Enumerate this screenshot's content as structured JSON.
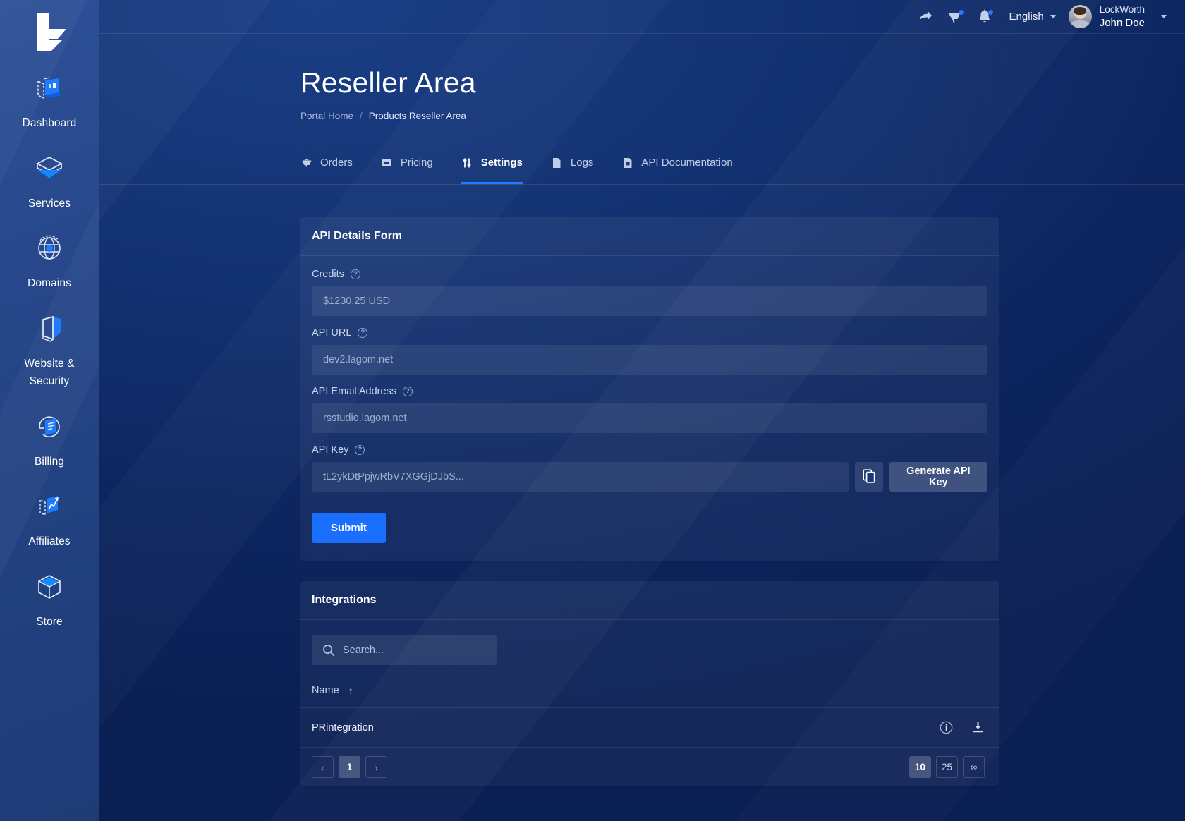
{
  "brand": {
    "logo_icon": "lagom-logo-icon"
  },
  "sidebar": {
    "items": [
      {
        "label": "Dashboard",
        "icon": "dashboard-icon"
      },
      {
        "label": "Services",
        "icon": "services-box-icon"
      },
      {
        "label": "Domains",
        "icon": "domains-globe-icon"
      },
      {
        "label": "Website &\nSecurity",
        "label_line1": "Website &",
        "label_line2": "Security",
        "icon": "website-security-shield-icon"
      },
      {
        "label": "Billing",
        "icon": "billing-invoice-icon"
      },
      {
        "label": "Affiliates",
        "icon": "affiliates-chart-icon"
      },
      {
        "label": "Store",
        "icon": "store-cube-icon"
      }
    ]
  },
  "topbar": {
    "share_icon": "share-arrow-icon",
    "cart_icon": "cart-icon",
    "bell_icon": "bell-notification-icon",
    "language": "English",
    "user": {
      "company": "LockWorth",
      "name": "John Doe",
      "avatar_icon": "avatar"
    }
  },
  "page": {
    "title": "Reseller Area",
    "breadcrumb": {
      "home": "Portal Home",
      "separator": "/",
      "current": "Products Reseller Area"
    }
  },
  "tabs": [
    {
      "label": "Orders",
      "icon": "cart-basket-icon",
      "active": false
    },
    {
      "label": "Pricing",
      "icon": "price-tag-icon",
      "active": false
    },
    {
      "label": "Settings",
      "icon": "sliders-icon",
      "active": true
    },
    {
      "label": "Logs",
      "icon": "file-icon",
      "active": false
    },
    {
      "label": "API Documentation",
      "icon": "document-api-icon",
      "active": false
    }
  ],
  "api_form": {
    "title": "API Details Form",
    "fields": [
      {
        "label": "Credits",
        "value": "$1230.25 USD",
        "help_icon": "help-icon"
      },
      {
        "label": "API URL",
        "value": "dev2.lagom.net",
        "help_icon": "help-icon"
      },
      {
        "label": "API Email Address",
        "value": "rsstudio.lagom.net",
        "help_icon": "help-icon"
      }
    ],
    "api_key": {
      "label": "API Key",
      "value": "tL2ykDtPpjwRbV7XGGjDJbS...",
      "copy_icon": "copy-icon",
      "generate_label": "Generate API Key"
    },
    "submit_label": "Submit"
  },
  "integrations": {
    "title": "Integrations",
    "search": {
      "placeholder": "Search...",
      "value": "",
      "icon": "search-icon"
    },
    "columns": [
      {
        "label": "Name",
        "sort": "↑"
      }
    ],
    "rows": [
      {
        "name": "PRintegration",
        "info_icon": "info-icon",
        "download_icon": "download-icon"
      }
    ],
    "pagination": {
      "prev": "‹",
      "pages": [
        "1"
      ],
      "next": "›",
      "current_page": "1",
      "page_sizes": [
        "10",
        "25",
        "∞"
      ],
      "active_page_size": "10"
    }
  },
  "colors": {
    "accent": "#1b6fff",
    "tab_underline": "#1f7bff",
    "sidebar_top": "#2e5098",
    "bg_deep": "#0a1f53",
    "badge_dot": "#2479ff"
  }
}
